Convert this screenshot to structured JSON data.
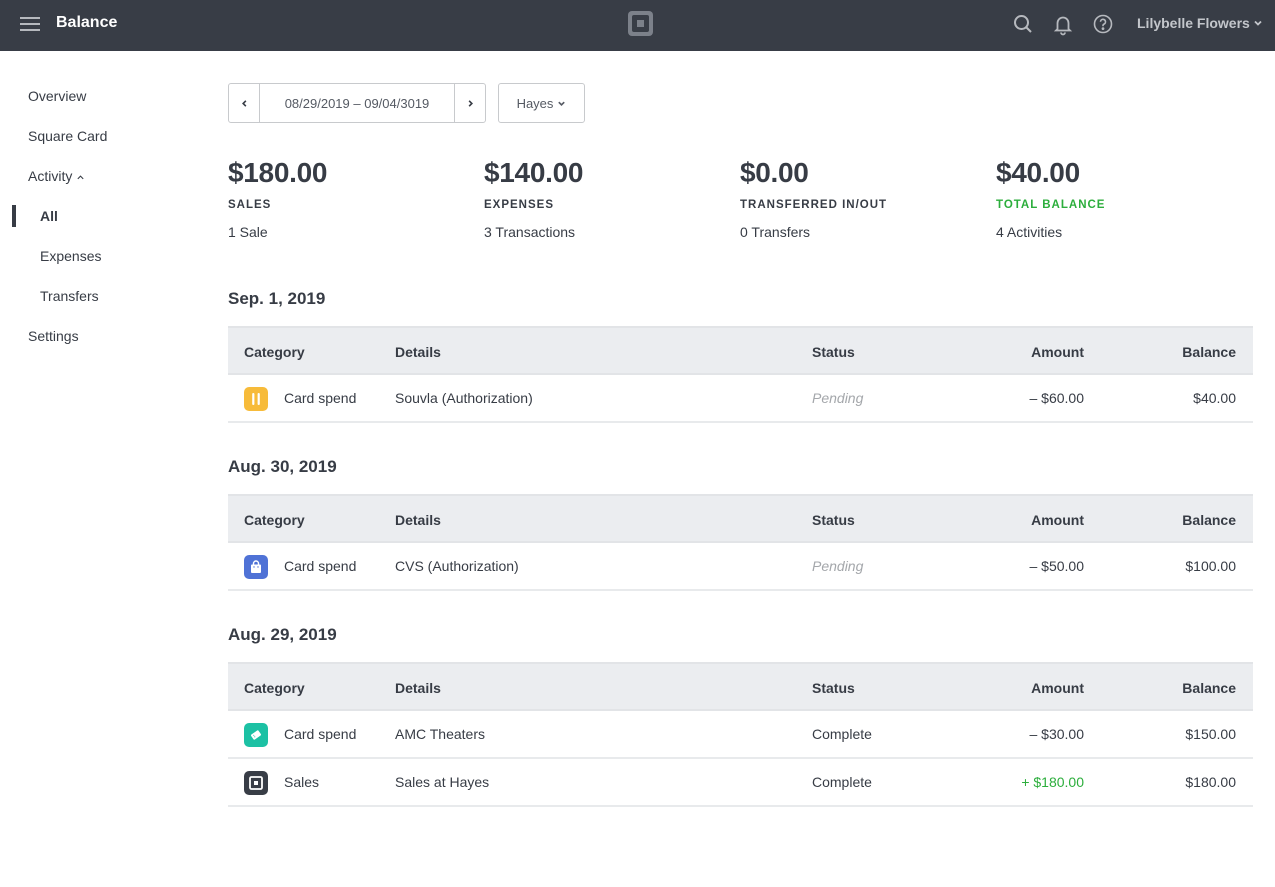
{
  "header": {
    "menu_icon": "hamburger-icon",
    "title": "Balance",
    "logo_icon": "square-logo-icon",
    "icons": [
      "search-icon",
      "bell-icon",
      "help-icon"
    ],
    "user_name": "Lilybelle Flowers"
  },
  "sidebar": {
    "items": [
      {
        "label": "Overview"
      },
      {
        "label": "Square Card"
      },
      {
        "label": "Activity"
      },
      {
        "label": "All",
        "active": true
      },
      {
        "label": "Expenses"
      },
      {
        "label": "Transfers"
      },
      {
        "label": "Settings"
      }
    ]
  },
  "filters": {
    "date_range": "08/29/2019 – 09/04/3019",
    "location": "Hayes"
  },
  "summary": [
    {
      "amount": "$180.00",
      "label": "SALES",
      "sub": "1 Sale"
    },
    {
      "amount": "$140.00",
      "label": "EXPENSES",
      "sub": "3 Transactions"
    },
    {
      "amount": "$0.00",
      "label": "TRANSFERRED IN/OUT",
      "sub": "0 Transfers"
    },
    {
      "amount": "$40.00",
      "label": "TOTAL BALANCE",
      "sub": "4 Activities",
      "color": "#2cae3c"
    }
  ],
  "table_headers": {
    "category": "Category",
    "details": "Details",
    "status": "Status",
    "amount": "Amount",
    "balance": "Balance"
  },
  "sections": [
    {
      "date": "Sep. 1, 2019",
      "rows": [
        {
          "icon": "utensils-icon",
          "icon_color": "#f7bb3a",
          "category": "Card spend",
          "details": "Souvla (Authorization)",
          "status": "Pending",
          "amount": "– $60.00",
          "balance": "$40.00"
        }
      ]
    },
    {
      "date": "Aug. 30, 2019",
      "rows": [
        {
          "icon": "shopping-bag-icon",
          "icon_color": "#4f72d6",
          "category": "Card spend",
          "details": "CVS (Authorization)",
          "status": "Pending",
          "amount": "– $50.00",
          "balance": "$100.00"
        }
      ]
    },
    {
      "date": "Aug. 29, 2019",
      "rows": [
        {
          "icon": "ticket-icon",
          "icon_color": "#1cc1a4",
          "category": "Card spend",
          "details": "AMC Theaters",
          "status": "Complete",
          "amount": "– $30.00",
          "balance": "$150.00"
        },
        {
          "icon": "square-logo-icon",
          "icon_color": "#383d46",
          "category": "Sales",
          "details": "Sales at Hayes",
          "status": "Complete",
          "amount": "+ $180.00",
          "balance": "$180.00"
        }
      ]
    }
  ]
}
